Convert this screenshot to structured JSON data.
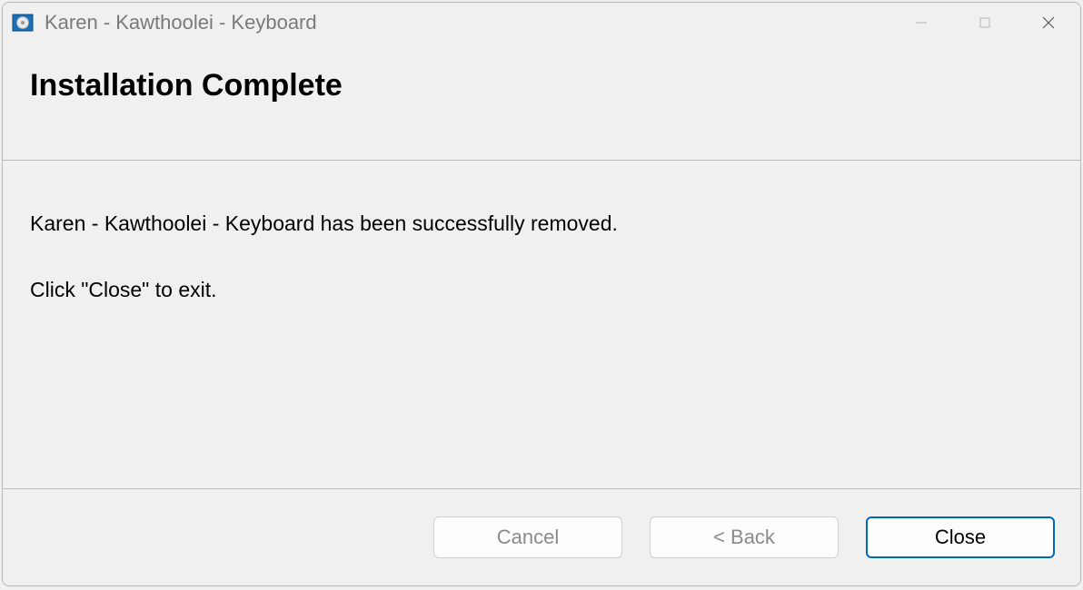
{
  "titlebar": {
    "title": "Karen - Kawthoolei - Keyboard"
  },
  "header": {
    "title": "Installation Complete"
  },
  "content": {
    "line1": "Karen - Kawthoolei - Keyboard has been successfully removed.",
    "line2": "Click \"Close\" to exit."
  },
  "footer": {
    "cancel_label": "Cancel",
    "back_label": "< Back",
    "close_label": "Close"
  }
}
